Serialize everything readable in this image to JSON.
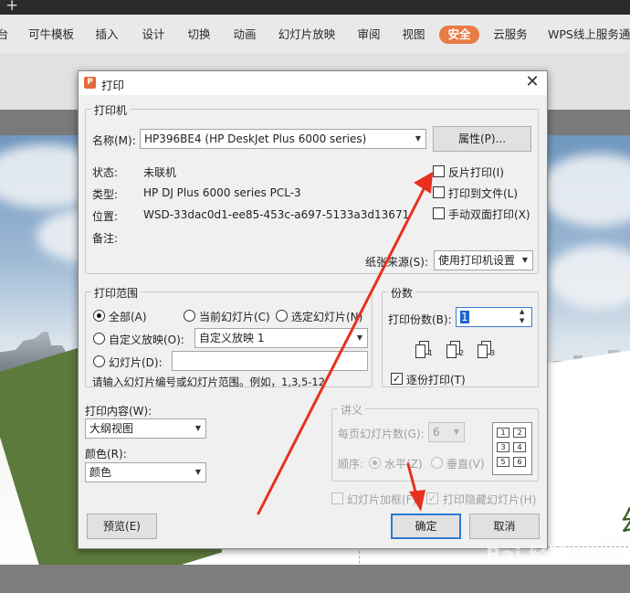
{
  "ribbon": {
    "tabs": [
      {
        "label": "台",
        "x": 0
      },
      {
        "label": "可牛模板"
      },
      {
        "label": "插入"
      },
      {
        "label": "设计"
      },
      {
        "label": "切换"
      },
      {
        "label": "动画"
      },
      {
        "label": "幻灯片放映"
      },
      {
        "label": "审阅"
      },
      {
        "label": "视图"
      },
      {
        "label": "安全"
      },
      {
        "label": "云服务"
      },
      {
        "label": "WPS线上服务通"
      }
    ],
    "active_tab": "安全"
  },
  "slide": {
    "visible_text": "单云",
    "big_char": "幻"
  },
  "dialog": {
    "title": "打印",
    "printer": {
      "group_title": "打印机",
      "name_label": "名称(M):",
      "name_value": "HP396BE4 (HP DeskJet Plus 6000 series)",
      "properties_button": "属性(P)...",
      "status_label": "状态:",
      "status_value": "未联机",
      "type_label": "类型:",
      "type_value": "HP DJ Plus 6000 series PCL-3",
      "location_label": "位置:",
      "location_value": "WSD-33dac0d1-ee85-453c-a697-5133a3d13671",
      "comment_label": "备注:",
      "reverse_print": "反片打印(I)",
      "print_to_file": "打印到文件(L)",
      "manual_duplex": "手动双面打印(X)",
      "paper_source_label": "纸张来源(S):",
      "paper_source_value": "使用打印机设置"
    },
    "range": {
      "group_title": "打印范围",
      "all": "全部(A)",
      "current": "当前幻灯片(C)",
      "selected": "选定幻灯片(N)",
      "custom_show": "自定义放映(O):",
      "custom_show_value": "自定义放映 1",
      "slides": "幻灯片(D):",
      "hint": "请输入幻灯片编号或幻灯片范围。例如，1,3,5-12"
    },
    "copies": {
      "group_title": "份数",
      "count_label": "打印份数(B):",
      "count_value": "1",
      "collate": "逐份打印(T)"
    },
    "content": {
      "label": "打印内容(W):",
      "value": "大纲视图",
      "color_label": "颜色(R):",
      "color_value": "颜色"
    },
    "handouts": {
      "group_title": "讲义",
      "per_page_label": "每页幻灯片数(G):",
      "per_page_value": "6",
      "order_label": "顺序:",
      "horizontal": "水平(Z)",
      "vertical": "垂直(V)",
      "grid": [
        "1",
        "2",
        "3",
        "4",
        "5",
        "6"
      ]
    },
    "frame_slides": "幻灯片加框(F)",
    "print_hidden": "打印隐藏幻灯片(H)",
    "preview_button": "预览(E)",
    "ok_button": "确定",
    "cancel_button": "取消"
  },
  "watermark": "Bai 经验",
  "colors": {
    "active_tab": "#ea7b45",
    "arrow": "#e8301e",
    "primary_border": "#2b79d8"
  }
}
